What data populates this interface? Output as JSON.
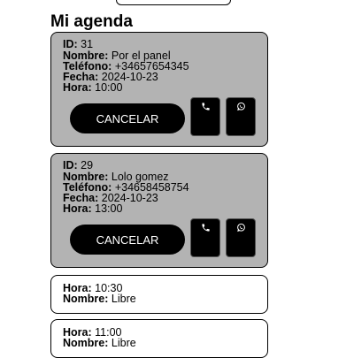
{
  "page": {
    "title": "Mi agenda"
  },
  "labels": {
    "id": "ID:",
    "nombre": "Nombre:",
    "telefono": "Teléfono:",
    "fecha": "Fecha:",
    "hora": "Hora:"
  },
  "appointments": [
    {
      "id": "31",
      "nombre": "Por el panel",
      "telefono": "+34657654345",
      "fecha": "2024-10-23",
      "hora": "10:00",
      "cancel_label": "CANCELAR",
      "call_icon": "phone-icon",
      "whatsapp_icon": "whatsapp-icon"
    },
    {
      "id": "29",
      "nombre": "Lolo gomez",
      "telefono": "+34658458754",
      "fecha": "2024-10-23",
      "hora": "13:00",
      "cancel_label": "CANCELAR",
      "call_icon": "phone-icon",
      "whatsapp_icon": "whatsapp-icon"
    }
  ],
  "free_slots": [
    {
      "hora": "10:30",
      "nombre": "Libre"
    },
    {
      "hora": "11:00",
      "nombre": "Libre"
    }
  ],
  "colors": {
    "booked_card_bg": "#b3b3b3",
    "free_card_bg": "#ffffff",
    "button_bg": "#000000",
    "button_text": "#ffffff"
  }
}
